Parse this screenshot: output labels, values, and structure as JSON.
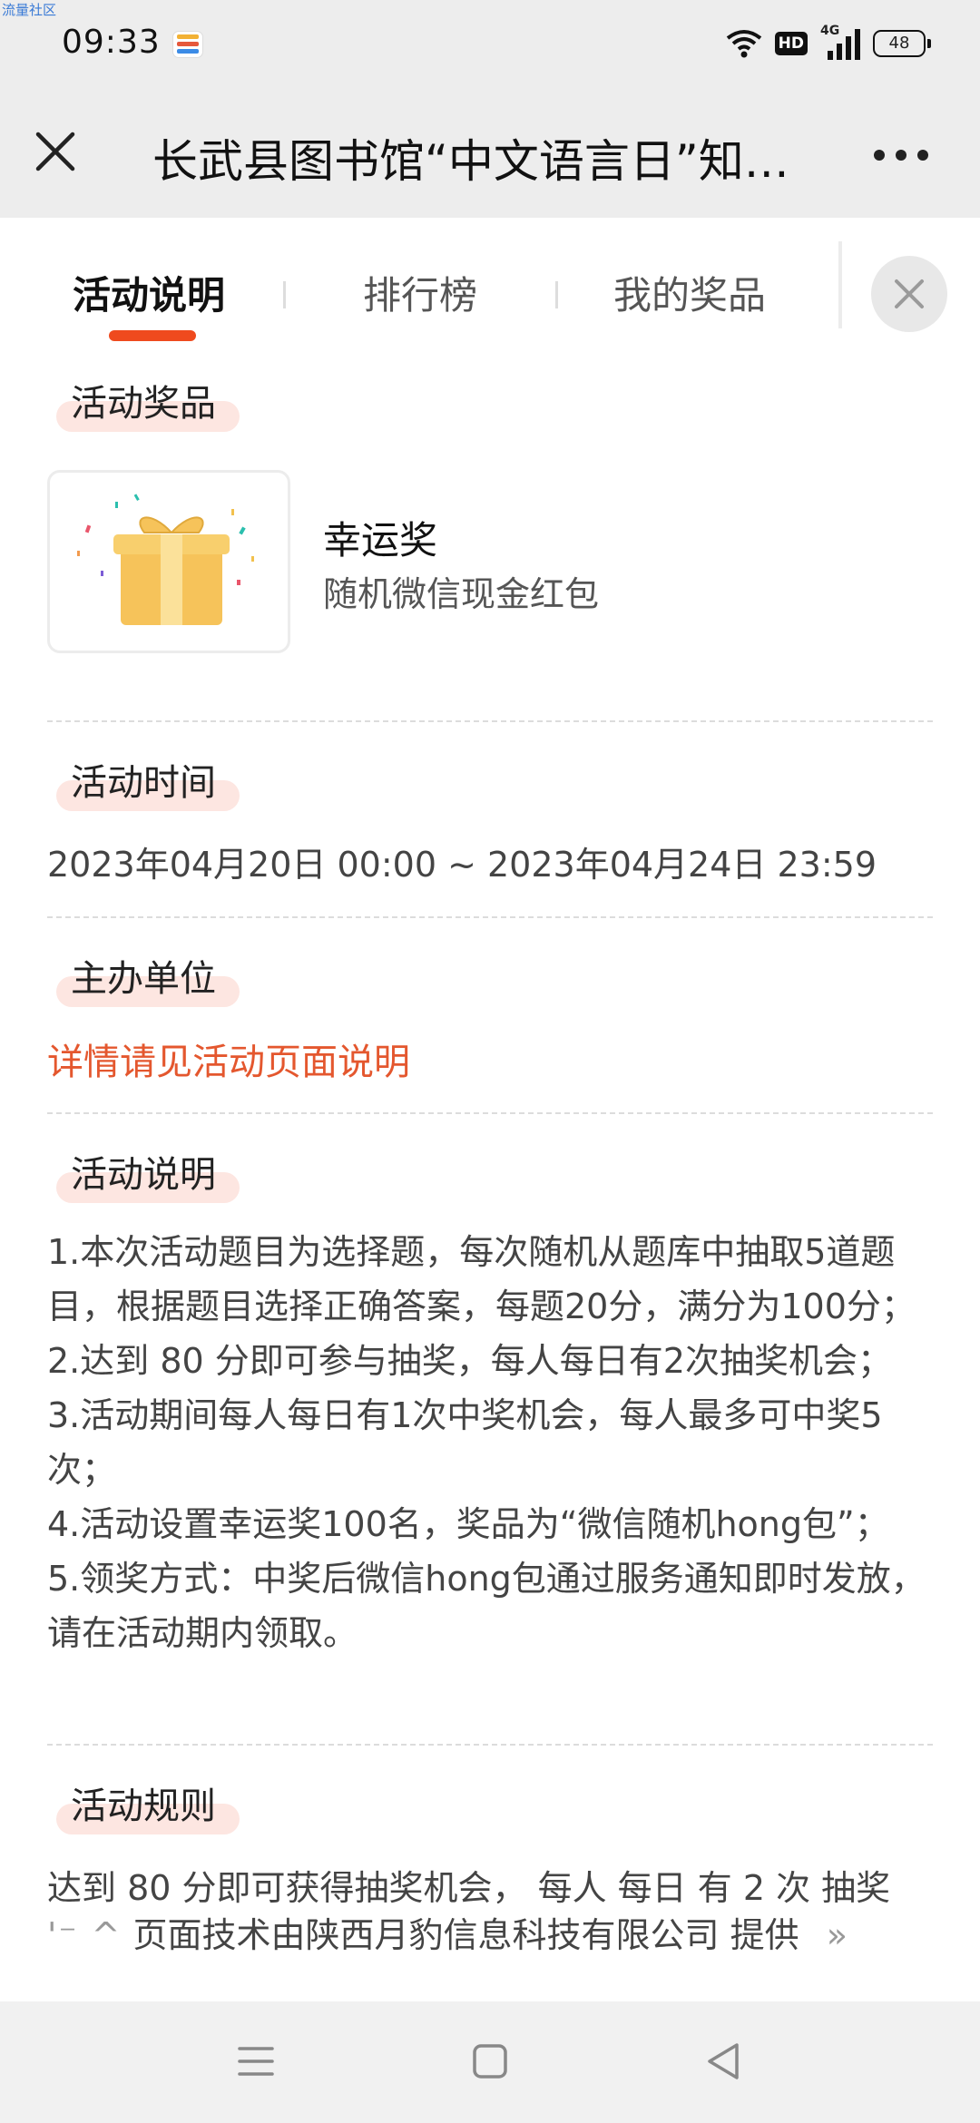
{
  "status_bar": {
    "watermark": "流量社区",
    "time": "09:33",
    "hd": "HD",
    "network": "4G",
    "battery": "48"
  },
  "title_bar": {
    "title": "长武县图书馆“中文语言日”知…"
  },
  "tabs": [
    {
      "label": "活动说明",
      "active": true
    },
    {
      "label": "排行榜",
      "active": false
    },
    {
      "label": "我的奖品",
      "active": false
    }
  ],
  "sections": {
    "prize": {
      "heading": "活动奖品",
      "name": "幸运奖",
      "desc": "随机微信现金红包"
    },
    "time": {
      "heading": "活动时间",
      "value": "2023年04月20日 00:00 ~ 2023年04月24日 23:59"
    },
    "organizer": {
      "heading": "主办单位",
      "value": "详情请见活动页面说明"
    },
    "description": {
      "heading": "活动说明",
      "lines": [
        "1.本次活动题目为选择题，每次随机从题库中抽取5道题目，根据题目选择正确答案，每题20分，满分为100分；",
        "2.达到 80 分即可参与抽奖，每人每日有2次抽奖机会；",
        "3.活动期间每人每日有1次中奖机会，每人最多可中奖5次；",
        "4.活动设置幸运奖100名，奖品为“微信随机hong包”；",
        "5.领奖方式：中奖后微信hong包通过服务通知即时发放，请在活动期内领取。"
      ]
    },
    "rules": {
      "heading": "活动规则",
      "text": "达到 80 分即可获得抽奖机会， 每人 每日 有 2 次 抽奖"
    }
  },
  "footer": {
    "fragment": "'⁻ ^",
    "provider": "页面技术由陕西月豹信息科技有限公司 提供",
    "chevron": "»"
  },
  "colors": {
    "accent": "#ef4a1e",
    "link": "#e4572e",
    "pill": "#fde6e1",
    "chrome": "#ededed"
  }
}
